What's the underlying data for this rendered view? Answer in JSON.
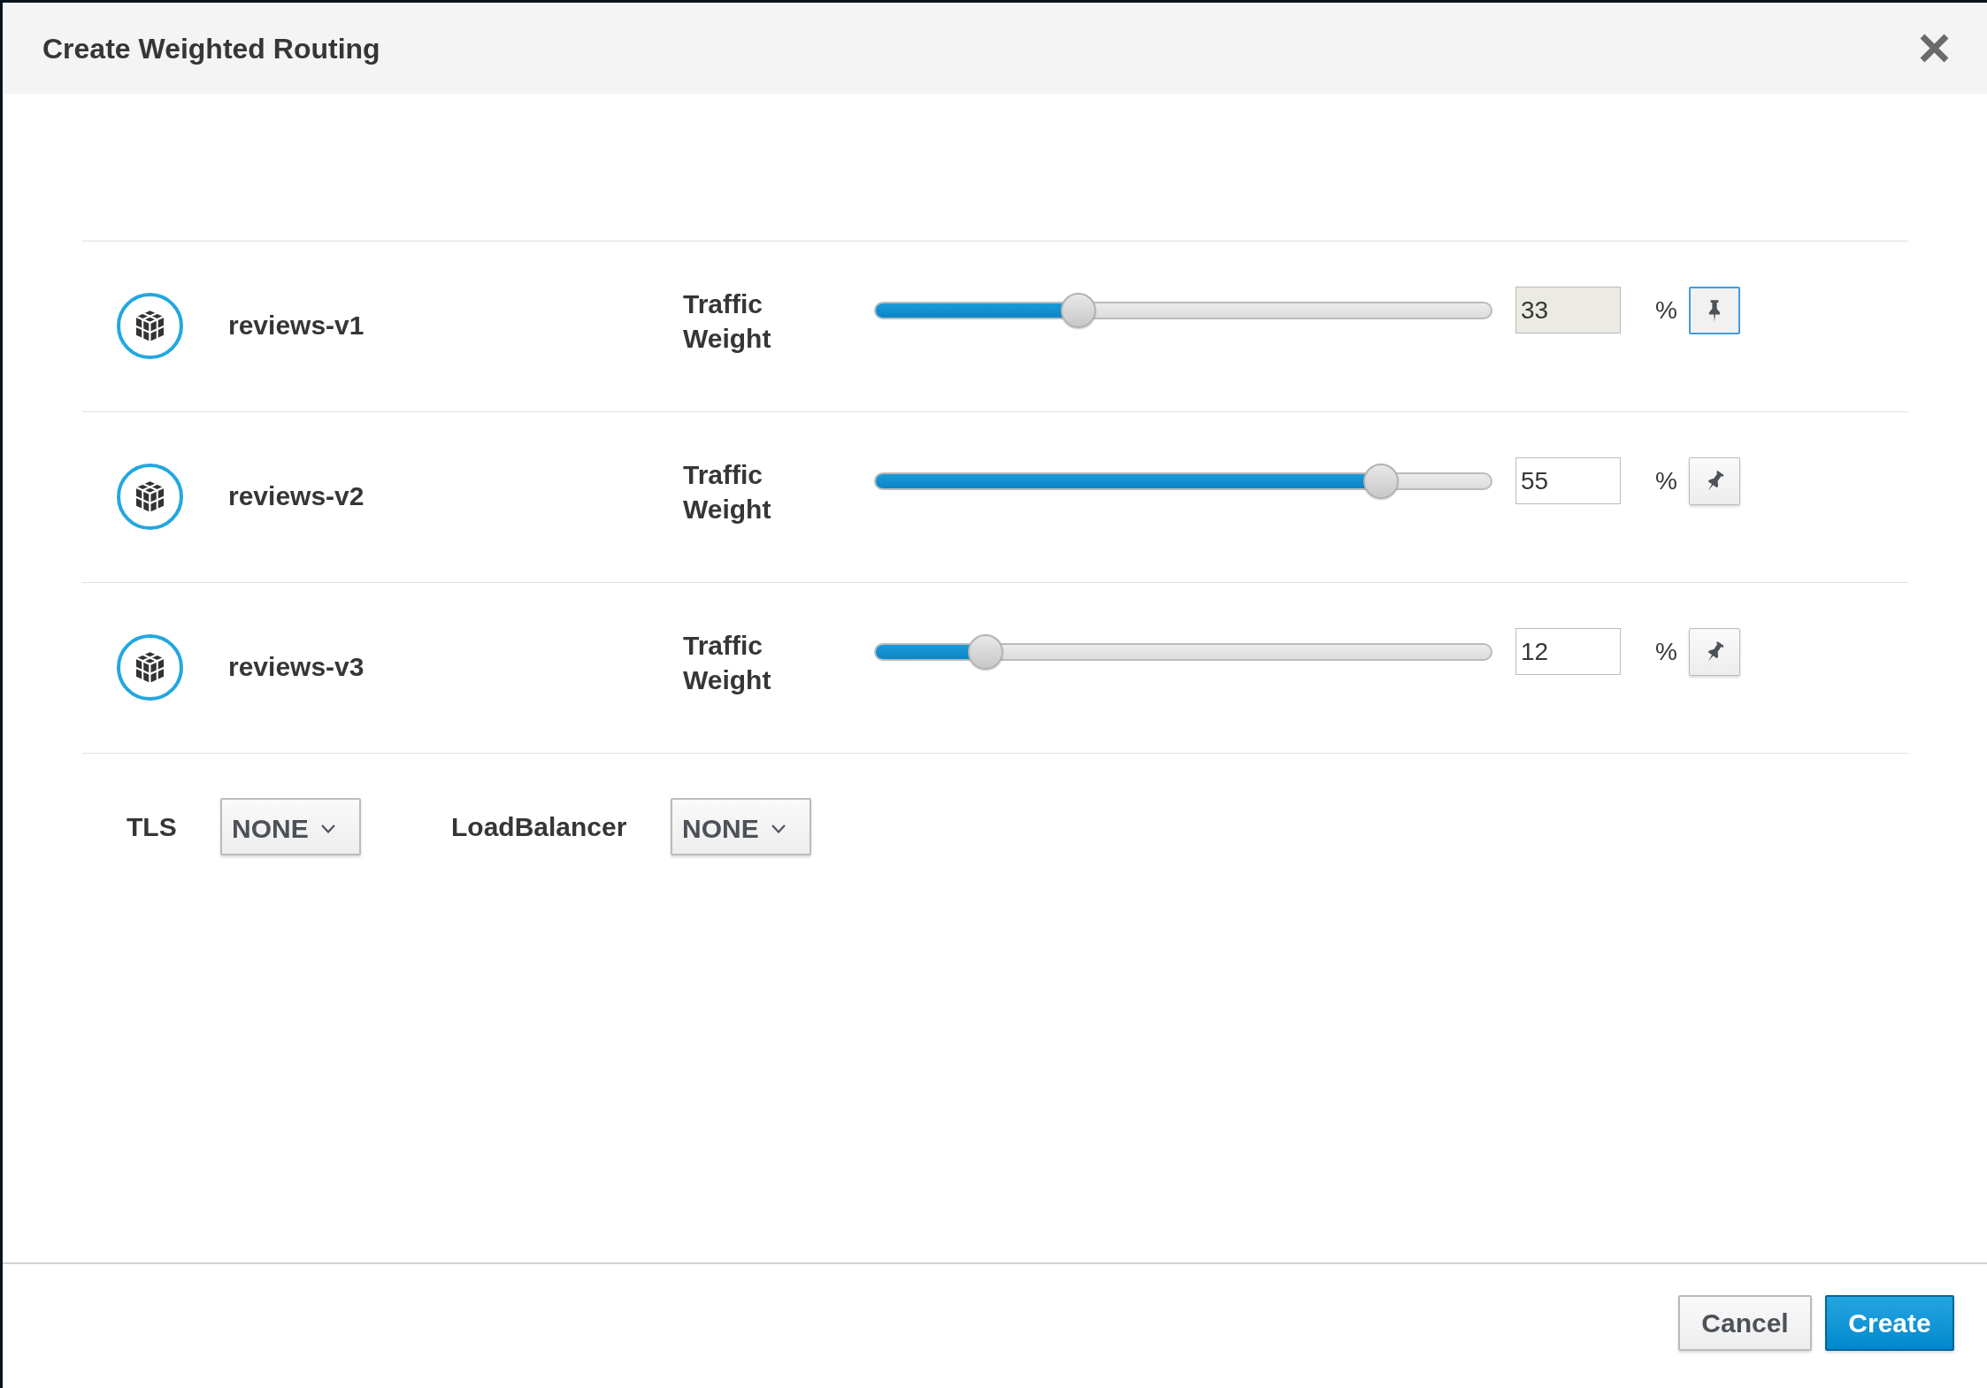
{
  "dialog": {
    "title": "Create Weighted Routing"
  },
  "services": [
    {
      "name": "reviews-v1",
      "weight_label": "Traffic Weight",
      "level": 0.33,
      "weight": "33",
      "unit": "%",
      "pinned": true
    },
    {
      "name": "reviews-v2",
      "weight_label": "Traffic Weight",
      "level": 0.82,
      "weight": "55",
      "unit": "%",
      "pinned": false
    },
    {
      "name": "reviews-v3",
      "weight_label": "Traffic Weight",
      "level": 0.18,
      "weight": "12",
      "unit": "%",
      "pinned": false
    }
  ],
  "options": [
    {
      "label": "TLS",
      "value": "NONE"
    },
    {
      "label": "LoadBalancer",
      "value": "NONE"
    }
  ],
  "buttons": [
    {
      "label": "Cancel",
      "kind": "secondary"
    },
    {
      "label": "Create",
      "kind": "primary"
    }
  ]
}
